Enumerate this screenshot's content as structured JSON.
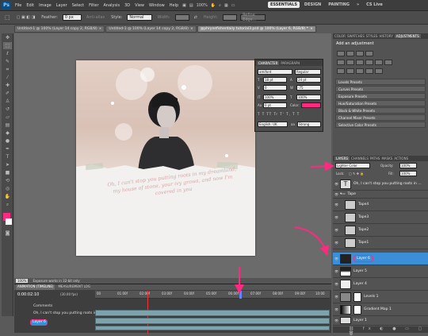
{
  "app": {
    "logo": "Ps",
    "zoom": "100%"
  },
  "menu": [
    "File",
    "Edit",
    "Image",
    "Layer",
    "Select",
    "Filter",
    "Analysis",
    "3D",
    "View",
    "Window",
    "Help"
  ],
  "workspace": {
    "essentials": "ESSENTIALS",
    "design": "DESIGN",
    "painting": "PAINTING",
    "more": "»",
    "cslive": "CS Live"
  },
  "options": {
    "feather_label": "Feather:",
    "feather_value": "0 px",
    "antialias": "Anti-alias",
    "style_label": "Style:",
    "style_value": "Normal",
    "width_label": "Width:",
    "height_label": "Height:",
    "refine": "Refine Edge..."
  },
  "tabs": [
    "Untitled-1 @ 100% (Layer 14 copy 2, RGB/8)",
    "Untitled-1 @ 100% (Layer 14 copy 2, RGB/8)",
    "@phrynefisherdaily tutorial3.psd @ 100% (Layer 6, RGB/8) *"
  ],
  "tool_icons": [
    "move-icon",
    "marquee-icon",
    "lasso-icon",
    "quick-select-icon",
    "crop-icon",
    "eyedropper-icon",
    "healing-icon",
    "brush-icon",
    "clone-stamp-icon",
    "history-brush-icon",
    "eraser-icon",
    "gradient-icon",
    "blur-icon",
    "dodge-icon",
    "pen-icon",
    "type-icon",
    "path-select-icon",
    "shape-icon",
    "3d-rotate-icon",
    "3d-orbit-icon",
    "hand-icon",
    "zoom-icon"
  ],
  "document": {
    "quote": "Oh, I can't stop you putting roots in my dreamland, my house of stone, your ivy grows, and now I'm covered in you"
  },
  "character_panel": {
    "tabs": [
      "CHARACTER",
      "PARAGRAPH"
    ],
    "font": "amifont",
    "style": "Regular",
    "size": "18 pt",
    "leading": "24 pt",
    "kerning": "0",
    "tracking": "-75",
    "vscale": "100%",
    "hscale": "100%",
    "baseline": "0 pt",
    "color_label": "Color:",
    "color": "#ff2a7f",
    "language": "English: UK",
    "aa": "Strong",
    "aa_label": "aa"
  },
  "status": {
    "zoom": "100%",
    "msg": "Exposure works in 32-bit only"
  },
  "timeline": {
    "tabs": [
      "ANIMATION (TIMELINE)",
      "MEASUREMENT LOG"
    ],
    "time": "0:00:02:10",
    "fps": "(30.00 fps)",
    "ticks": [
      "00",
      "01:00f",
      "02:00f",
      "03:00f",
      "04:00f",
      "05:00f",
      "06:00f",
      "07:00f",
      "08:00f",
      "09:00f",
      "10:00"
    ],
    "rows": [
      "Comments",
      "Oh, I can't stop you putting roots in my...",
      "Layer 6"
    ]
  },
  "adjustments": {
    "tabs": [
      "COLOR",
      "SWATCHES",
      "STYLES",
      "HISTORY",
      "ADJUSTMENTS"
    ],
    "title": "Add an adjustment",
    "presets": [
      "Levels Presets",
      "Curves Presets",
      "Exposure Presets",
      "Hue/Saturation Presets",
      "Black & White Presets",
      "Channel Mixer Presets",
      "Selective Color Presets"
    ]
  },
  "layers": {
    "tabs": [
      "LAYERS",
      "CHANNELS",
      "PATHS",
      "MASKS",
      "ACTIONS"
    ],
    "blend": "Lighter Color",
    "opacity_label": "Opacity:",
    "opacity": "100%",
    "lock_label": "Lock:",
    "fill_label": "Fill:",
    "fill": "100%",
    "items": [
      "Oh, I can't stop you putting roots in ...",
      "Tape",
      "Tape4",
      "Tape3",
      "Tape2",
      "Tape1",
      "Layer 6",
      "Layer 5",
      "Layer 4",
      "Levels 1",
      "Gradient Map 1",
      "Layer 1"
    ],
    "selected": "Layer 6"
  },
  "colors": {
    "accent": "#ff2a7f",
    "selection": "#3a8fd8",
    "track": "#7fa3ad"
  }
}
